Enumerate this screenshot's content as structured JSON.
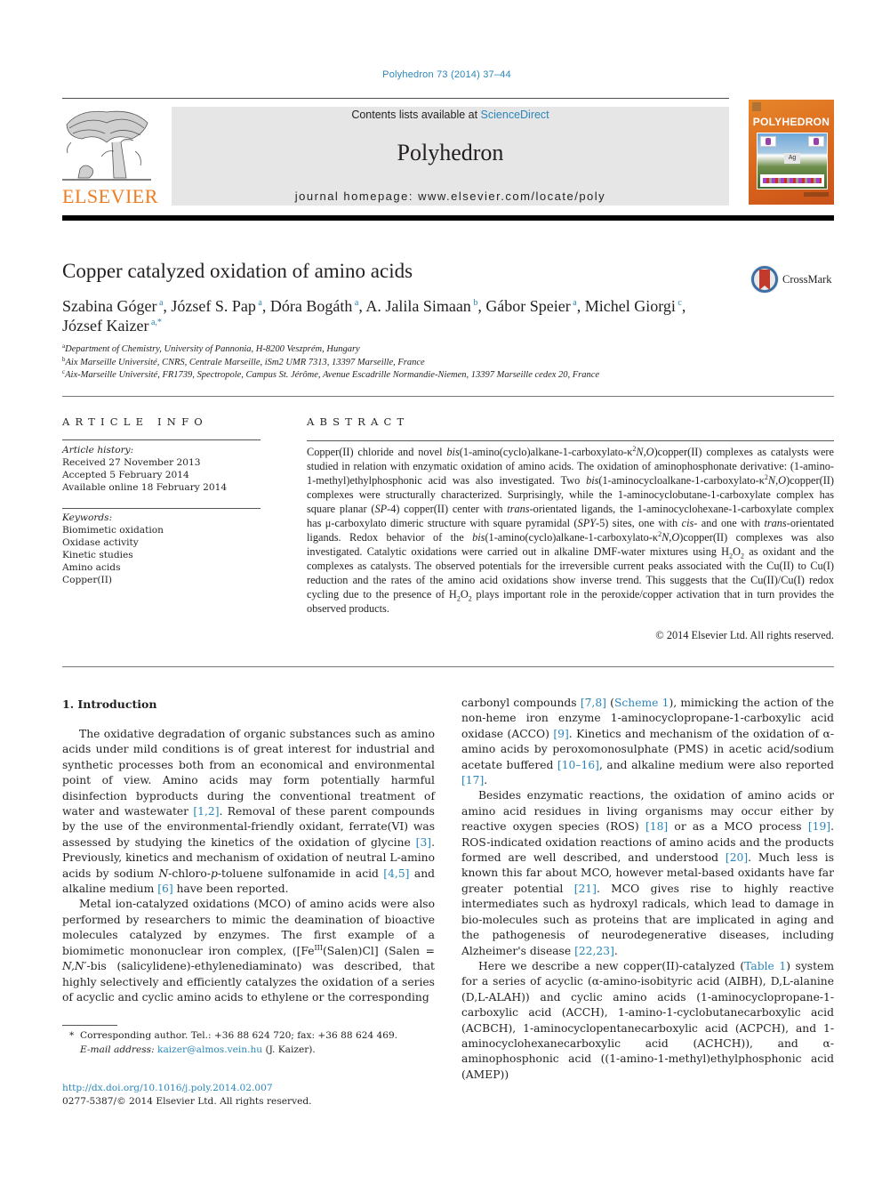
{
  "header": {
    "citation": "Polyhedron 73 (2014) 37–44",
    "publisher_logo_text": "ELSEVIER",
    "contents_prefix": "Contents lists available at ",
    "contents_link": "ScienceDirect",
    "journal_title": "Polyhedron",
    "homepage_prefix": "journal homepage: ",
    "homepage_url": "www.elsevier.com/locate/poly",
    "cover": {
      "title": "POLYHEDRON",
      "badge": "Ag"
    },
    "colors": {
      "link": "#2a86b9",
      "elsevier_orange": "#ee7d22",
      "banner_bg": "#e6e6e6"
    }
  },
  "article": {
    "title": "Copper catalyzed oxidation of amino acids",
    "crossmark_label": "CrossMark",
    "authors": [
      {
        "name": "Szabina Góger",
        "aff": "a",
        "sep": ", "
      },
      {
        "name": "József S. Pap",
        "aff": "a",
        "sep": ", "
      },
      {
        "name": "Dóra Bogáth",
        "aff": "a",
        "sep": ", "
      },
      {
        "name": "A. Jalila Simaan",
        "aff": "b",
        "sep": ", "
      },
      {
        "name": "Gábor Speier",
        "aff": "a",
        "sep": ", "
      },
      {
        "name": "Michel Giorgi",
        "aff": "c",
        "sep": ","
      },
      {
        "name": "József Kaizer",
        "aff": "a,*",
        "sep": ""
      }
    ],
    "affiliations": [
      {
        "mark": "a",
        "text": "Department of Chemistry, University of Pannonia, H-8200 Veszprém, Hungary"
      },
      {
        "mark": "b",
        "text": "Aix Marseille Université, CNRS, Centrale Marseille, iSm2 UMR 7313, 13397 Marseille, France"
      },
      {
        "mark": "c",
        "text": "Aix-Marseille Université, FR1739, Spectropole, Campus St. Jérôme, Avenue Escadrille Normandie-Niemen, 13397 Marseille cedex 20, France"
      }
    ]
  },
  "article_info": {
    "heading": "ARTICLE INFO",
    "history_label": "Article history:",
    "history": [
      "Received 27 November 2013",
      "Accepted 5 February 2014",
      "Available online 18 February 2014"
    ],
    "keywords_label": "Keywords:",
    "keywords": [
      "Biomimetic oxidation",
      "Oxidase activity",
      "Kinetic studies",
      "Amino acids",
      "Copper(II)"
    ]
  },
  "abstract": {
    "heading": "ABSTRACT",
    "segments": [
      {
        "t": "Copper(II) chloride and novel "
      },
      {
        "i": "bis"
      },
      {
        "t": "(1-amino(cyclo)alkane-1-carboxylato-κ"
      },
      {
        "sup": "2"
      },
      {
        "i": "N,O"
      },
      {
        "t": ")copper(II) complexes as catalysts were studied in relation with enzymatic oxidation of amino acids. The oxidation of aminophosphonate derivative: (1-amino-1-methyl)ethylphosphonic acid was also investigated. Two "
      },
      {
        "i": "bis"
      },
      {
        "t": "(1-aminocycloalkane-1-carboxylato-κ"
      },
      {
        "sup": "2"
      },
      {
        "i": "N,O"
      },
      {
        "t": ")copper(II) complexes were structurally characterized. Surprisingly, while the 1-aminocyclobutane-1-carboxylate complex has square planar ("
      },
      {
        "i": "SP"
      },
      {
        "t": "-4) copper(II) center with "
      },
      {
        "i": "trans"
      },
      {
        "t": "-orientated ligands, the 1-aminocyclohexane-1-carboxylate complex has μ-carboxylato dimeric structure with square pyramidal ("
      },
      {
        "i": "SPY"
      },
      {
        "t": "-5) sites, one with "
      },
      {
        "i": "cis"
      },
      {
        "t": "- and one with "
      },
      {
        "i": "trans"
      },
      {
        "t": "-orientated ligands. Redox behavior of the "
      },
      {
        "i": "bis"
      },
      {
        "t": "(1-amino(cyclo)alkane-1-carboxylato-κ"
      },
      {
        "sup": "2"
      },
      {
        "i": "N,O"
      },
      {
        "t": ")copper(II) complexes was also investigated. Catalytic oxidations were carried out in alkaline DMF-water mixtures using H"
      },
      {
        "sub": "2"
      },
      {
        "t": "O"
      },
      {
        "sub": "2"
      },
      {
        "t": " as oxidant and the complexes as catalysts. The observed potentials for the irreversible current peaks associated with the Cu(II) to Cu(I) reduction and the rates of the amino acid oxidations show inverse trend. This suggests that the Cu(II)/Cu(I) redox cycling due to the presence of H"
      },
      {
        "sub": "2"
      },
      {
        "t": "O"
      },
      {
        "sub": "2"
      },
      {
        "t": " plays important role in the peroxide/copper activation that in turn provides the observed products."
      }
    ],
    "copyright": "© 2014 Elsevier Ltd. All rights reserved."
  },
  "body": {
    "section_heading": "1. Introduction",
    "left_paragraphs": [
      [
        {
          "t": "The oxidative degradation of organic substances such as amino acids under mild conditions is of great interest for industrial and synthetic processes both from an economical and environmental point of view. Amino acids may form potentially harmful disinfection byproducts during the conventional treatment of water and wastewater "
        },
        {
          "ref": "[1,2]"
        },
        {
          "t": ". Removal of these parent compounds by the use of the environmental-friendly oxidant, ferrate(VI) was assessed by studying the kinetics of the oxidation of glycine "
        },
        {
          "ref": "[3]"
        },
        {
          "t": ". Previously, kinetics and mechanism of oxidation of neutral L-amino acids by sodium "
        },
        {
          "i": "N"
        },
        {
          "t": "-chloro-"
        },
        {
          "i": "p"
        },
        {
          "t": "-toluene sulfonamide in acid "
        },
        {
          "ref": "[4,5]"
        },
        {
          "t": " and alkaline medium "
        },
        {
          "ref": "[6]"
        },
        {
          "t": " have been reported."
        }
      ],
      [
        {
          "t": "Metal ion-catalyzed oxidations (MCO) of amino acids were also performed by researchers to mimic the deamination of bioactive molecules catalyzed by enzymes. The first example of a biomimetic mononuclear iron complex, ([Fe"
        },
        {
          "sup": "III"
        },
        {
          "t": "(Salen)Cl] (Salen = "
        },
        {
          "i": "N,N′"
        },
        {
          "t": "-bis (salicylidene)-ethylenediaminato) was described, that highly selectively and efficiently catalyzes the oxidation of a series of acyclic and cyclic amino acids to ethylene or the corresponding"
        }
      ]
    ],
    "right_paragraphs": [
      [
        {
          "t": "carbonyl compounds "
        },
        {
          "ref": "[7,8]"
        },
        {
          "t": " ("
        },
        {
          "ref": "Scheme 1"
        },
        {
          "t": "), mimicking the action of the non-heme iron enzyme 1-aminocyclopropane-1-carboxylic acid oxidase (ACCO) "
        },
        {
          "ref": "[9]"
        },
        {
          "t": ". Kinetics and mechanism of the oxidation of α-amino acids by peroxomonosulphate (PMS) in acetic acid/sodium acetate buffered "
        },
        {
          "ref": "[10–16]"
        },
        {
          "t": ", and alkaline medium were also reported "
        },
        {
          "ref": "[17]"
        },
        {
          "t": "."
        }
      ],
      [
        {
          "t": "Besides enzymatic reactions, the oxidation of amino acids or amino acid residues in living organisms may occur either by reactive oxygen species (ROS) "
        },
        {
          "ref": "[18]"
        },
        {
          "t": " or as a MCO process "
        },
        {
          "ref": "[19]"
        },
        {
          "t": ". ROS-indicated oxidation reactions of amino acids and the products formed are well described, and understood "
        },
        {
          "ref": "[20]"
        },
        {
          "t": ". Much less is known this far about MCO, however metal-based oxidants have far greater potential "
        },
        {
          "ref": "[21]"
        },
        {
          "t": ". MCO gives rise to highly reactive intermediates such as hydroxyl radicals, which lead to damage in bio-molecules such as proteins that are implicated in aging and the pathogenesis of neurodegenerative diseases, including Alzheimer's disease "
        },
        {
          "ref": "[22,23]"
        },
        {
          "t": "."
        }
      ],
      [
        {
          "t": "Here we describe a new copper(II)-catalyzed ("
        },
        {
          "ref": "Table 1"
        },
        {
          "t": ") system for a series of acyclic (α-amino-isobityric acid (AIBH), D,L-alanine (D,L-ALAH)) and cyclic amino acids (1-aminocyclopropane-1-carboxylic acid (ACCH), 1-amino-1-cyclobutanecarboxylic acid (ACBCH), 1-aminocyclopentanecarboxylic acid (ACPCH), and 1-aminocyclohexanecarboxylic acid (ACHCH)), and α-aminophosphonic acid ((1-amino-1-methyl)ethylphosphonic acid (AMEP))"
        }
      ]
    ]
  },
  "footnote": {
    "marker": "*",
    "corresponding": "Corresponding author. Tel.: +36 88 624 720; fax: +36 88 624 469.",
    "email_label": "E-mail address:",
    "email": "kaizer@almos.vein.hu",
    "email_suffix": " (J. Kaizer)."
  },
  "footer": {
    "doi": "http://dx.doi.org/10.1016/j.poly.2014.02.007",
    "issn_line": "0277-5387/© 2014 Elsevier Ltd. All rights reserved."
  }
}
